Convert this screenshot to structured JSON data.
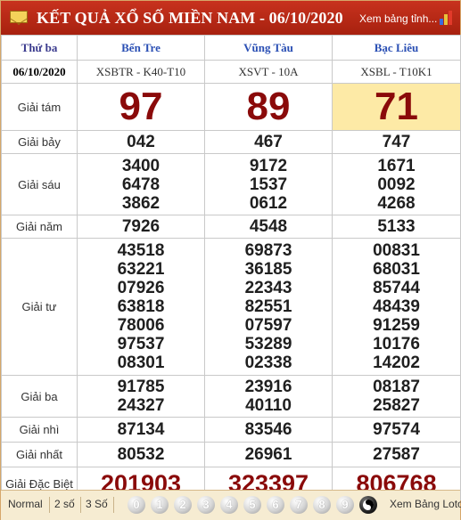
{
  "header": {
    "title": "KẾT QUẢ XỔ SỐ MIỀN NAM - 06/10/2020",
    "view_link": "Xem bảng tỉnh..."
  },
  "table": {
    "weekday": "Thứ ba",
    "date": "06/10/2020",
    "provinces": [
      {
        "name": "Bến Tre",
        "code": "XSBTR - K40-T10"
      },
      {
        "name": "Vũng Tàu",
        "code": "XSVT - 10A"
      },
      {
        "name": "Bạc Liêu",
        "code": "XSBL - T10K1"
      }
    ],
    "prizes": {
      "g8": {
        "label": "Giải tám",
        "values": [
          [
            "97"
          ],
          [
            "89"
          ],
          [
            "71"
          ]
        ]
      },
      "g7": {
        "label": "Giải bảy",
        "values": [
          [
            "042"
          ],
          [
            "467"
          ],
          [
            "747"
          ]
        ]
      },
      "g6": {
        "label": "Giải sáu",
        "values": [
          [
            "3400",
            "6478",
            "3862"
          ],
          [
            "9172",
            "1537",
            "0612"
          ],
          [
            "1671",
            "0092",
            "4268"
          ]
        ]
      },
      "g5": {
        "label": "Giải năm",
        "values": [
          [
            "7926"
          ],
          [
            "4548"
          ],
          [
            "5133"
          ]
        ]
      },
      "g4": {
        "label": "Giải tư",
        "values": [
          [
            "43518",
            "63221",
            "07926",
            "63818",
            "78006",
            "97537",
            "08301"
          ],
          [
            "69873",
            "36185",
            "22343",
            "82551",
            "07597",
            "53289",
            "02338"
          ],
          [
            "00831",
            "68031",
            "85744",
            "48439",
            "91259",
            "10176",
            "14202"
          ]
        ]
      },
      "g3": {
        "label": "Giải ba",
        "values": [
          [
            "91785",
            "24327"
          ],
          [
            "23916",
            "40110"
          ],
          [
            "08187",
            "25827"
          ]
        ]
      },
      "g2": {
        "label": "Giải nhì",
        "values": [
          [
            "87134"
          ],
          [
            "83546"
          ],
          [
            "97574"
          ]
        ]
      },
      "g1": {
        "label": "Giải nhất",
        "values": [
          [
            "80532"
          ],
          [
            "26961"
          ],
          [
            "27587"
          ]
        ]
      },
      "special": {
        "label": "Giải Đặc Biệt",
        "values": [
          [
            "201903"
          ],
          [
            "323397"
          ],
          [
            "806768"
          ]
        ]
      }
    }
  },
  "footer": {
    "buttons": [
      "Normal",
      "2 số",
      "3 Số"
    ],
    "balls": [
      "0",
      "1",
      "2",
      "3",
      "4",
      "5",
      "6",
      "7",
      "8",
      "9"
    ],
    "loto_link": "Xem Bảng Loto"
  },
  "colors": {
    "header_bg": "#b52814",
    "province_text": "#2a4fb4",
    "big_number": "#8a0a0a",
    "highlight": "#fdeaa6",
    "footer_bg": "#f6ecd2"
  },
  "icons": {
    "header_left": "envelope-icon",
    "header_right": "bar-chart-icon",
    "footer_ball_special": "yin-yang-icon"
  }
}
